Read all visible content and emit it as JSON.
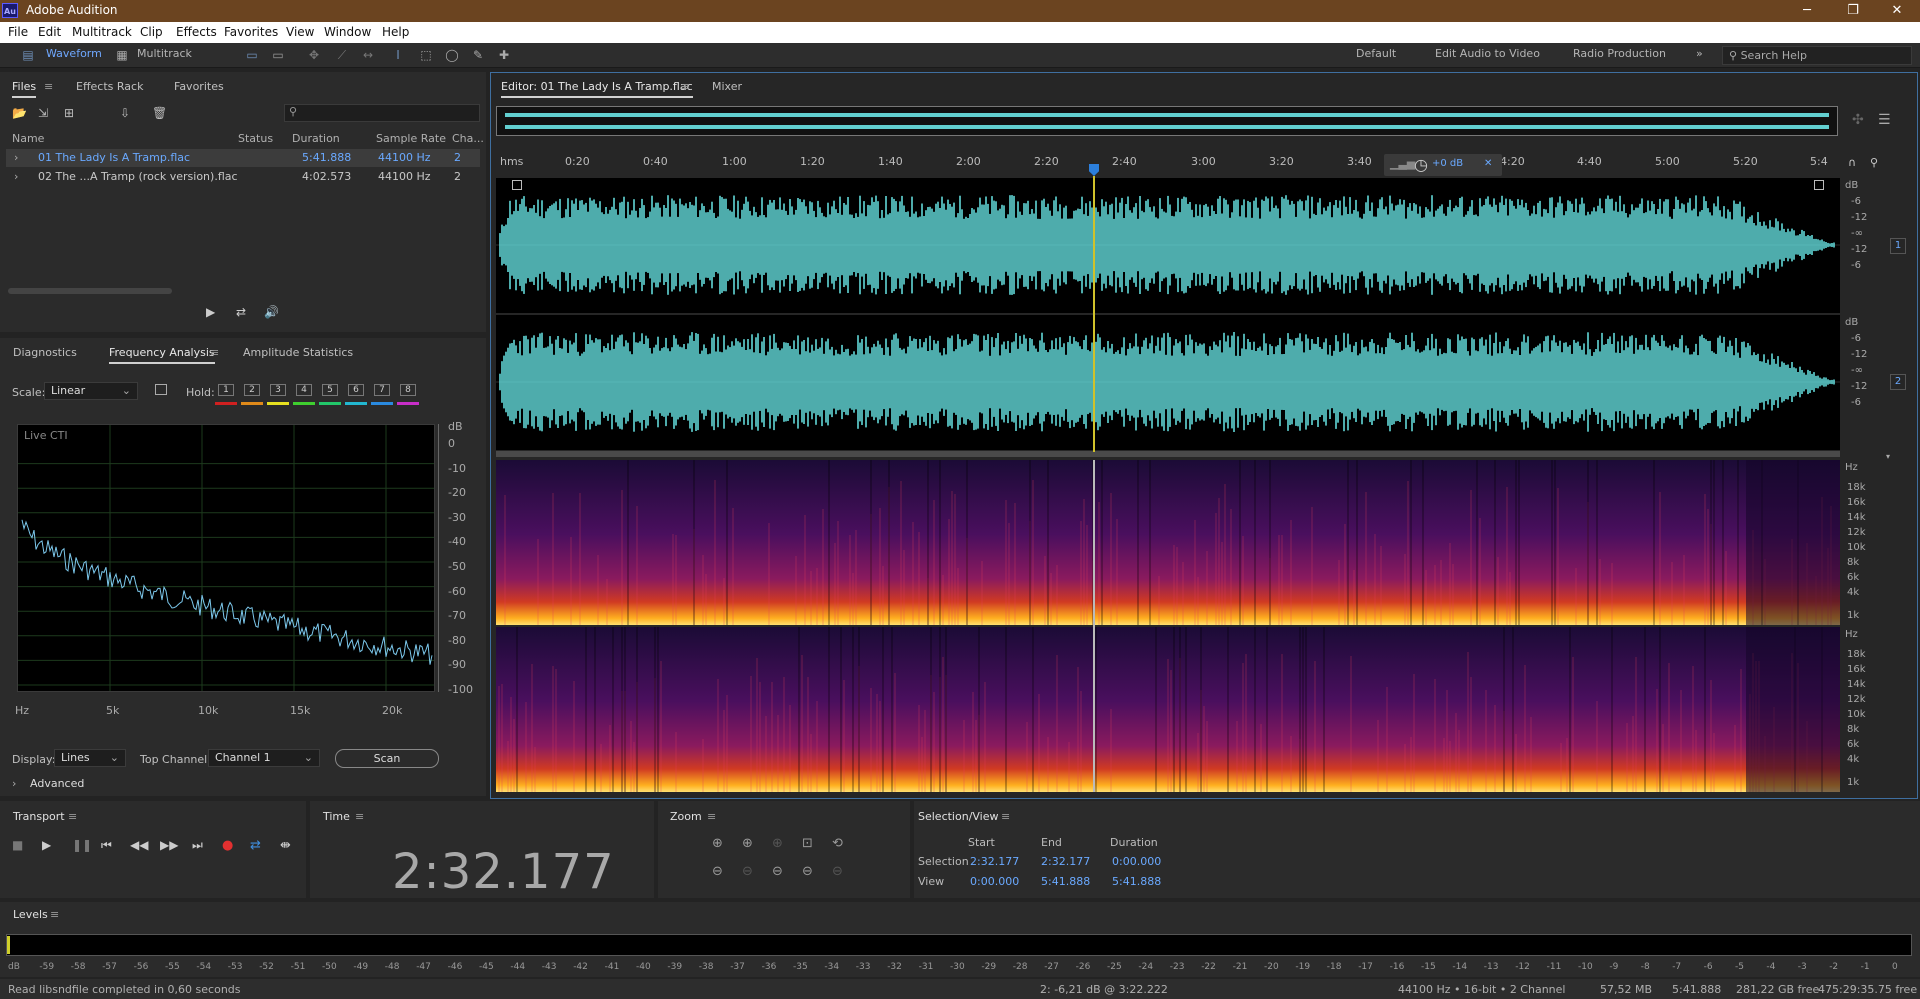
{
  "app": {
    "title": "Adobe Audition",
    "logo": "Au"
  },
  "menus": [
    "File",
    "Edit",
    "Multitrack",
    "Clip",
    "Effects",
    "Favorites",
    "View",
    "Window",
    "Help"
  ],
  "toolbar": {
    "waveform": "Waveform",
    "multitrack": "Multitrack",
    "workspaces": [
      "Default",
      "Edit Audio to Video",
      "Radio Production"
    ],
    "search_placeholder": "Search Help"
  },
  "files": {
    "tabs": [
      "Files",
      "Effects Rack",
      "Favorites"
    ],
    "columns": [
      "Name",
      "Status",
      "Duration",
      "Sample Rate",
      "Cha..."
    ],
    "rows": [
      {
        "name": "01 The Lady Is A Tramp.flac",
        "duration": "5:41.888",
        "rate": "44100 Hz",
        "ch": "2"
      },
      {
        "name": "02 The ...A Tramp (rock version).flac",
        "duration": "4:02.573",
        "rate": "44100 Hz",
        "ch": "2"
      }
    ]
  },
  "analysis": {
    "tabs": [
      "Diagnostics",
      "Frequency Analysis",
      "Amplitude Statistics"
    ],
    "scale_label": "Scale:",
    "scale_value": "Linear",
    "hold_label": "Hold:",
    "holds": [
      "1",
      "2",
      "3",
      "4",
      "5",
      "6",
      "7",
      "8"
    ],
    "hold_colors": [
      "#d02020",
      "#e08a1a",
      "#e6e020",
      "#3fcf2f",
      "#22c76a",
      "#22b7d0",
      "#2a8ae0",
      "#c82ec8"
    ],
    "plot_label": "Live CTI",
    "db_unit": "dB",
    "db_ticks": [
      "0",
      "-10",
      "-20",
      "-30",
      "-40",
      "-50",
      "-60",
      "-70",
      "-80",
      "-90",
      "-100"
    ],
    "freq_ticks": [
      "Hz",
      "5k",
      "10k",
      "15k",
      "20k"
    ],
    "display_label": "Display:",
    "display_value": "Lines",
    "topch_label": "Top Channel:",
    "topch_value": "Channel 1",
    "scan": "Scan",
    "advanced": "Advanced"
  },
  "editor": {
    "tab": "Editor: 01 The Lady Is A Tramp.flac",
    "mixer": "Mixer",
    "time_unit": "hms",
    "ticks": [
      "0:20",
      "0:40",
      "1:00",
      "1:20",
      "1:40",
      "2:00",
      "2:20",
      "2:40",
      "3:00",
      "3:20",
      "3:40",
      "4:20",
      "4:40",
      "5:00",
      "5:20",
      "5:4"
    ],
    "gain": "+0 dB",
    "wave_db": [
      "dB",
      "-6",
      "-12",
      "-∞",
      "-12",
      "-6"
    ],
    "ch1": "1",
    "ch2": "2",
    "hz_ticks": [
      "Hz",
      "18k",
      "16k",
      "14k",
      "12k",
      "10k",
      "8k",
      "6k",
      "4k",
      "1k"
    ]
  },
  "transport": {
    "title": "Transport"
  },
  "time": {
    "title": "Time",
    "value": "2:32.177"
  },
  "zoom": {
    "title": "Zoom"
  },
  "selection": {
    "title": "Selection/View",
    "cols": [
      "Start",
      "End",
      "Duration"
    ],
    "sel_label": "Selection",
    "view_label": "View",
    "sel": [
      "2:32.177",
      "2:32.177",
      "0:00.000"
    ],
    "view": [
      "0:00.000",
      "5:41.888",
      "5:41.888"
    ]
  },
  "levels": {
    "title": "Levels",
    "ticks": [
      "dB",
      "-59",
      "-58",
      "-57",
      "-56",
      "-55",
      "-54",
      "-53",
      "-52",
      "-51",
      "-50",
      "-49",
      "-48",
      "-47",
      "-46",
      "-45",
      "-44",
      "-43",
      "-42",
      "-41",
      "-40",
      "-39",
      "-38",
      "-37",
      "-36",
      "-35",
      "-34",
      "-33",
      "-32",
      "-31",
      "-30",
      "-29",
      "-28",
      "-27",
      "-26",
      "-25",
      "-24",
      "-23",
      "-22",
      "-21",
      "-20",
      "-19",
      "-18",
      "-17",
      "-16",
      "-15",
      "-14",
      "-13",
      "-12",
      "-11",
      "-10",
      "-9",
      "-8",
      "-7",
      "-6",
      "-5",
      "-4",
      "-3",
      "-2",
      "-1",
      "0"
    ]
  },
  "status": {
    "msg": "Read libsndfile completed in 0,60 seconds",
    "cursor": "2: -6,21 dB @ 3:22.222",
    "format": "44100 Hz • 16-bit • 2 Channel",
    "size": "57,52 MB",
    "dur": "5:41.888",
    "free": "281,22 GB free",
    "freetime": "475:29:35.75 free"
  }
}
